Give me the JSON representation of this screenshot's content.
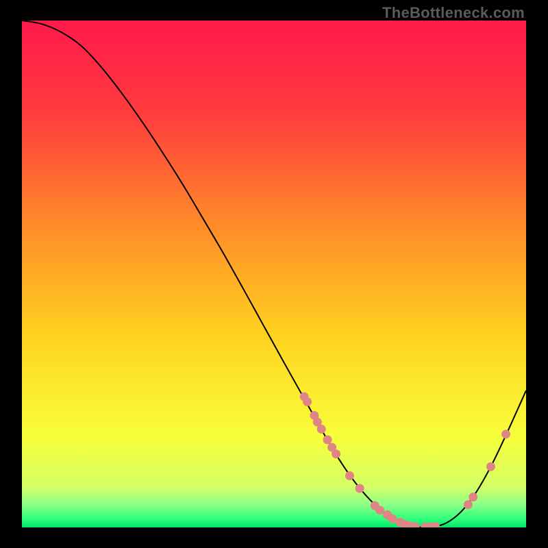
{
  "watermark": "TheBottleneck.com",
  "chart_data": {
    "type": "line",
    "title": "",
    "xlabel": "",
    "ylabel": "",
    "xlim": [
      0,
      100
    ],
    "ylim": [
      0,
      100
    ],
    "grid": false,
    "legend": false,
    "background_gradient": {
      "stops": [
        {
          "offset": 0.0,
          "color": "#ff1a4b"
        },
        {
          "offset": 0.18,
          "color": "#ff3b3d"
        },
        {
          "offset": 0.4,
          "color": "#ff8a2a"
        },
        {
          "offset": 0.62,
          "color": "#ffd21f"
        },
        {
          "offset": 0.82,
          "color": "#f7ff3a"
        },
        {
          "offset": 0.92,
          "color": "#d4ff66"
        },
        {
          "offset": 0.955,
          "color": "#8dff88"
        },
        {
          "offset": 0.985,
          "color": "#2aff7b"
        },
        {
          "offset": 1.0,
          "color": "#00e569"
        }
      ]
    },
    "series": [
      {
        "name": "curve",
        "color": "#000000",
        "width": 2,
        "x": [
          0,
          4,
          8,
          12,
          16,
          20,
          24,
          28,
          32,
          36,
          40,
          44,
          48,
          52,
          56,
          60,
          63,
          66,
          69,
          72,
          75,
          78,
          81,
          84,
          87,
          90,
          93,
          96,
          100
        ],
        "y": [
          100,
          99.3,
          97.6,
          94.8,
          90.5,
          85.4,
          79.8,
          73.8,
          67.5,
          60.8,
          54.0,
          46.9,
          39.7,
          32.5,
          25.4,
          18.3,
          13.3,
          9.0,
          5.5,
          2.8,
          1.0,
          0.15,
          0.05,
          0.8,
          3.0,
          6.8,
          12.0,
          18.2,
          27.0
        ]
      }
    ],
    "markers": {
      "name": "dots",
      "color": "#e08585",
      "radius": 6.5,
      "points": [
        {
          "x": 56.0,
          "y": 25.8
        },
        {
          "x": 56.6,
          "y": 24.8
        },
        {
          "x": 58.0,
          "y": 22.1
        },
        {
          "x": 58.6,
          "y": 20.8
        },
        {
          "x": 59.4,
          "y": 19.4
        },
        {
          "x": 60.6,
          "y": 17.3
        },
        {
          "x": 61.5,
          "y": 15.8
        },
        {
          "x": 62.3,
          "y": 14.5
        },
        {
          "x": 65.0,
          "y": 10.2
        },
        {
          "x": 67.0,
          "y": 7.7
        },
        {
          "x": 70.0,
          "y": 4.3
        },
        {
          "x": 71.0,
          "y": 3.4
        },
        {
          "x": 72.5,
          "y": 2.5
        },
        {
          "x": 73.5,
          "y": 1.7
        },
        {
          "x": 75.0,
          "y": 1.0
        },
        {
          "x": 76.0,
          "y": 0.6
        },
        {
          "x": 77.0,
          "y": 0.3
        },
        {
          "x": 78.0,
          "y": 0.15
        },
        {
          "x": 80.0,
          "y": 0.1
        },
        {
          "x": 81.0,
          "y": 0.1
        },
        {
          "x": 82.0,
          "y": 0.2
        },
        {
          "x": 88.5,
          "y": 4.5
        },
        {
          "x": 89.5,
          "y": 6.0
        },
        {
          "x": 93.0,
          "y": 12.0
        },
        {
          "x": 96.0,
          "y": 18.4
        }
      ]
    }
  }
}
